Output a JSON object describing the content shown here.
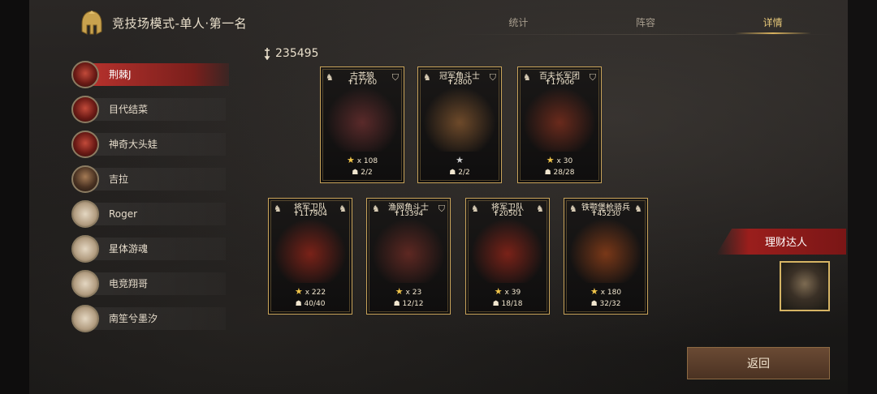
{
  "header": {
    "title": "竞技场模式-单人·第一名"
  },
  "tabs": [
    {
      "label": "统计",
      "active": false
    },
    {
      "label": "阵容",
      "active": false
    },
    {
      "label": "详情",
      "active": true
    }
  ],
  "players": [
    {
      "name": "荆棘J",
      "avatar": "demon",
      "active": true
    },
    {
      "name": "目代结菜",
      "avatar": "demon",
      "active": false
    },
    {
      "name": "神奇大头娃",
      "avatar": "demon",
      "active": false
    },
    {
      "name": "吉拉",
      "avatar": "man",
      "active": false
    },
    {
      "name": "Roger",
      "avatar": "horse",
      "active": false
    },
    {
      "name": "星体游魂",
      "avatar": "horse",
      "active": false
    },
    {
      "name": "电竞翔哥",
      "avatar": "horse",
      "active": false
    },
    {
      "name": "南笙兮墨汐",
      "avatar": "horse",
      "active": false
    }
  ],
  "total_power": "235495",
  "cards": [
    {
      "name": "古苍狼",
      "power": "17760",
      "stars": "x 108",
      "count": "2/2",
      "star_color": "gold",
      "art_color": "#5a2a2a"
    },
    {
      "name": "冠军角斗士",
      "power": "2800",
      "stars": "",
      "count": "2/2",
      "star_color": "grey",
      "art_color": "#6e4a2a"
    },
    {
      "name": "百夫长军团",
      "power": "17906",
      "stars": "x 30",
      "count": "28/28",
      "star_color": "gold",
      "art_color": "#6a2a1c"
    },
    {
      "name": "将军卫队",
      "power": "117904",
      "stars": "x 222",
      "count": "40/40",
      "star_color": "gold",
      "art_color": "#7a2218"
    },
    {
      "name": "渔网角斗士",
      "power": "13394",
      "stars": "x 23",
      "count": "12/12",
      "star_color": "gold",
      "art_color": "#5e2822"
    },
    {
      "name": "将军卫队",
      "power": "20501",
      "stars": "x 39",
      "count": "18/18",
      "star_color": "gold",
      "art_color": "#7a2218"
    },
    {
      "name": "铁颚堡枪骑兵",
      "power": "45230",
      "stars": "x 180",
      "count": "32/32",
      "star_color": "gold",
      "art_color": "#7a3818"
    }
  ],
  "badge": {
    "label": "理财达人"
  },
  "back_button": {
    "label": "返回"
  }
}
